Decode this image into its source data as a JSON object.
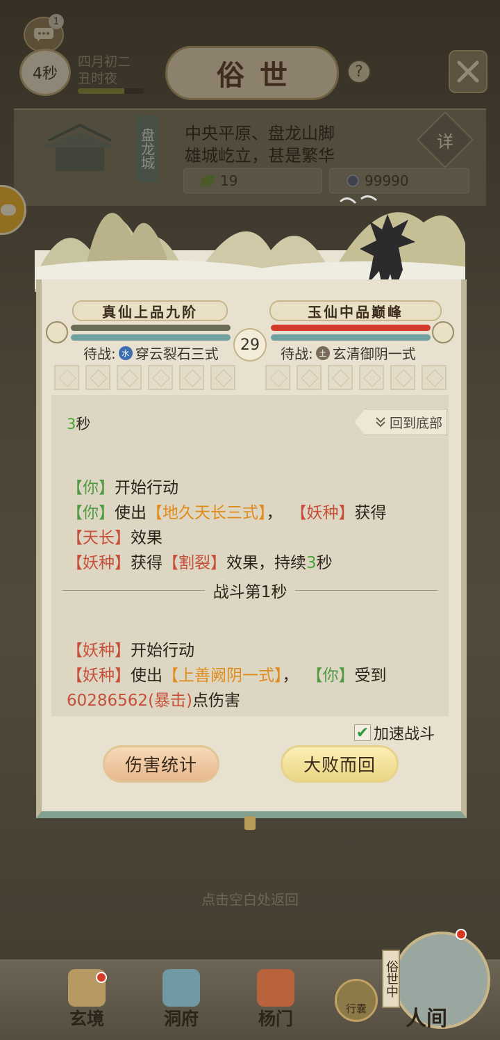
{
  "top": {
    "chat_badge": "1",
    "timer": "4秒",
    "date_line1": "四月初二",
    "date_line2": "丑时夜",
    "day_progress": 0.7,
    "title": "俗世",
    "help_icon": "?"
  },
  "location": {
    "city": "盘龙城",
    "line1": "中央平原、盘龙山脚",
    "line2": "雄城屹立，甚是繁华",
    "detail_label": "详",
    "herb_count": "19",
    "coin_count": "99990"
  },
  "battle": {
    "player_rank": "真仙上品九阶",
    "enemy_rank": "玉仙中品巅峰",
    "player_hp": 1.0,
    "enemy_hp": 1.0,
    "round": "29",
    "player_skill_prefix": "待战:",
    "player_skill_element": "水",
    "player_skill": "穿云裂石三式",
    "enemy_skill_prefix": "待战:",
    "enemy_skill_element": "土",
    "enemy_skill": "玄清御阴一式"
  },
  "log": {
    "time_num": "3",
    "time_unit": "秒",
    "back_label": "回到底部",
    "divider": "战斗第1秒",
    "tags": {
      "you": "【你】",
      "foe": "【妖种】",
      "skill1": "【地久天长三式】",
      "effect1": "【天长】",
      "effect2": "【割裂】",
      "skill2": "【上善阙阴一式】"
    },
    "text": {
      "start_action": "开始行动",
      "use": "使出",
      "comma": "，",
      "gain": "获得",
      "effect": "效果",
      "effect_lasting": "效果，持续",
      "seconds": "秒",
      "receive": "受到",
      "damage": "点伤害"
    },
    "duration": "3",
    "damage_value": "60286562(暴击)"
  },
  "controls": {
    "speed_label": "加速战斗",
    "speed_checked": true,
    "stats_button": "伤害统计",
    "retreat_button": "大败而回",
    "hint": "点击空白处返回"
  },
  "nav": {
    "items": [
      "玄境",
      "洞府",
      "杨门"
    ],
    "bag": "行囊",
    "world_tag": "俗世中",
    "world_label": "人间"
  },
  "colors": {
    "you": "#4f9a42",
    "foe": "#c64f3a",
    "skill": "#de8c1c",
    "hp_player": "#6a6c54",
    "hp_enemy": "#d23b2c"
  }
}
